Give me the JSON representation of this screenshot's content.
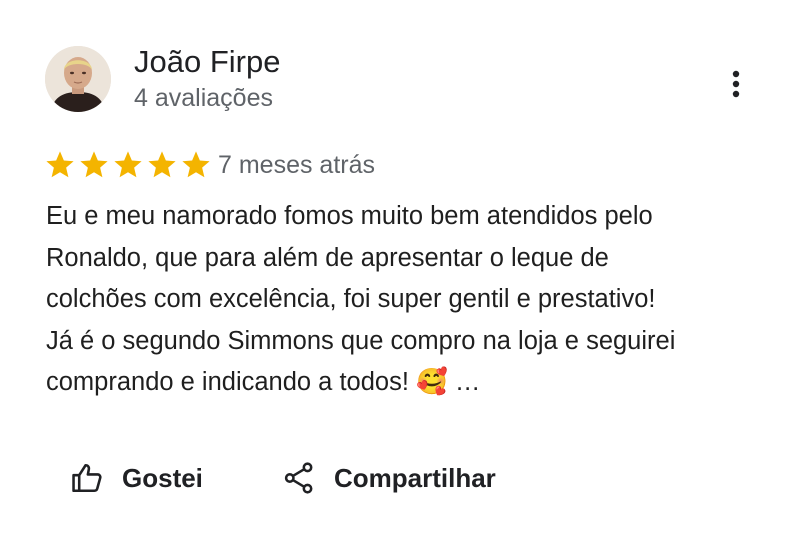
{
  "reviewer": {
    "name": "João Firpe",
    "review_count": "4 avaliações",
    "avatar_icon": "person-photo"
  },
  "menu": {
    "icon": "more-vertical-icon"
  },
  "review": {
    "rating": 5,
    "rating_max": 5,
    "star_color": "#f4b400",
    "time_ago": "7 meses atrás",
    "text_lines": [
      "Eu e meu namorado fomos muito bem atendidos pelo",
      "Ronaldo, que para além de apresentar o leque de",
      "colchões com excelência, foi super gentil e prestativo!",
      "Já é o segundo Simmons que compro na loja e seguirei",
      "comprando e indicando a todos! 🥰"
    ],
    "more_label": "…"
  },
  "actions": {
    "like_label": "Gostei",
    "like_icon": "thumbs-up-icon",
    "share_label": "Compartilhar",
    "share_icon": "share-icon"
  }
}
